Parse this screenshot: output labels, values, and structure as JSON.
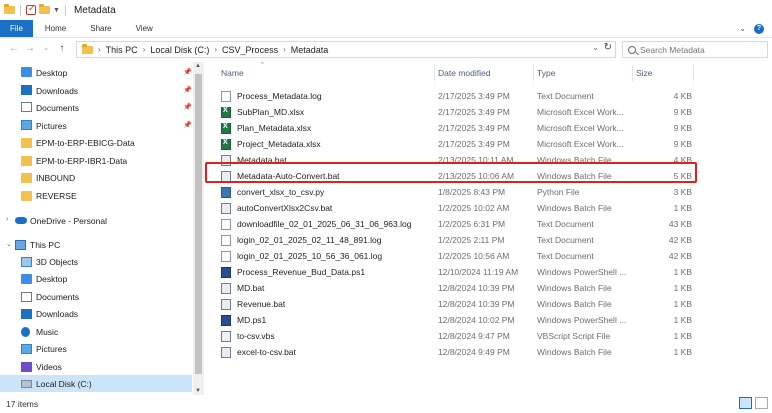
{
  "window": {
    "title": "Metadata"
  },
  "ribbon": {
    "tabs": [
      "File",
      "Home",
      "Share",
      "View"
    ],
    "chevron": "⌄",
    "help": "?"
  },
  "address": {
    "segments": [
      "This PC",
      "Local Disk (C:)",
      "CSV_Process",
      "Metadata"
    ],
    "search_placeholder": "Search Metadata"
  },
  "nav": {
    "items": [
      {
        "label": "Desktop",
        "icon": "desktop-icon",
        "pinned": true
      },
      {
        "label": "Downloads",
        "icon": "downloads-icon",
        "pinned": true
      },
      {
        "label": "Documents",
        "icon": "documents-icon",
        "pinned": true
      },
      {
        "label": "Pictures",
        "icon": "pictures-icon",
        "pinned": true
      },
      {
        "label": "EPM-to-ERP-EBICG-Data",
        "icon": "folder-icon"
      },
      {
        "label": "EPM-to-ERP-IBR1-Data",
        "icon": "folder-icon"
      },
      {
        "label": "INBOUND",
        "icon": "folder-icon"
      },
      {
        "label": "REVERSE",
        "icon": "folder-icon"
      },
      {
        "label": "OneDrive - Personal",
        "icon": "onedrive-icon"
      },
      {
        "label": "This PC",
        "icon": "this-pc-icon"
      },
      {
        "label": "3D Objects",
        "icon": "3d-objects-icon"
      },
      {
        "label": "Desktop",
        "icon": "desktop-icon"
      },
      {
        "label": "Documents",
        "icon": "documents-icon"
      },
      {
        "label": "Downloads",
        "icon": "downloads-icon"
      },
      {
        "label": "Music",
        "icon": "music-icon"
      },
      {
        "label": "Pictures",
        "icon": "pictures-icon"
      },
      {
        "label": "Videos",
        "icon": "videos-icon"
      },
      {
        "label": "Local Disk (C:)",
        "icon": "local-disk-icon",
        "selected": true
      }
    ]
  },
  "columns": {
    "name": "Name",
    "date": "Date modified",
    "type": "Type",
    "size": "Size"
  },
  "files": [
    {
      "name": "Process_Metadata.log",
      "date": "2/17/2025 3:49 PM",
      "type": "Text Document",
      "size": "4 KB",
      "kind": "log"
    },
    {
      "name": "SubPlan_MD.xlsx",
      "date": "2/17/2025 3:49 PM",
      "type": "Microsoft Excel Work...",
      "size": "9 KB",
      "kind": "xlsx"
    },
    {
      "name": "Plan_Metadata.xlsx",
      "date": "2/17/2025 3:49 PM",
      "type": "Microsoft Excel Work...",
      "size": "9 KB",
      "kind": "xlsx"
    },
    {
      "name": "Project_Metadata.xlsx",
      "date": "2/17/2025 3:49 PM",
      "type": "Microsoft Excel Work...",
      "size": "9 KB",
      "kind": "xlsx"
    },
    {
      "name": "Metadata.bat",
      "date": "2/13/2025 10:11 AM",
      "type": "Windows Batch File",
      "size": "4 KB",
      "kind": "bat"
    },
    {
      "name": "Metadata-Auto-Convert.bat",
      "date": "2/13/2025 10:06 AM",
      "type": "Windows Batch File",
      "size": "5 KB",
      "kind": "bat",
      "highlighted": true
    },
    {
      "name": "convert_xlsx_to_csv.py",
      "date": "1/8/2025 8:43 PM",
      "type": "Python File",
      "size": "3 KB",
      "kind": "py"
    },
    {
      "name": "autoConvertXlsx2Csv.bat",
      "date": "1/2/2025 10:02 AM",
      "type": "Windows Batch File",
      "size": "1 KB",
      "kind": "bat"
    },
    {
      "name": "downloadfile_02_01_2025_06_31_06_963.log",
      "date": "1/2/2025 6:31 PM",
      "type": "Text Document",
      "size": "43 KB",
      "kind": "log"
    },
    {
      "name": "login_02_01_2025_02_11_48_891.log",
      "date": "1/2/2025 2:11 PM",
      "type": "Text Document",
      "size": "42 KB",
      "kind": "log"
    },
    {
      "name": "login_02_01_2025_10_56_36_061.log",
      "date": "1/2/2025 10:56 AM",
      "type": "Text Document",
      "size": "42 KB",
      "kind": "log"
    },
    {
      "name": "Process_Revenue_Bud_Data.ps1",
      "date": "12/10/2024 11:19 AM",
      "type": "Windows PowerShell ...",
      "size": "1 KB",
      "kind": "ps1"
    },
    {
      "name": "MD.bat",
      "date": "12/8/2024 10:39 PM",
      "type": "Windows Batch File",
      "size": "1 KB",
      "kind": "bat"
    },
    {
      "name": "Revenue.bat",
      "date": "12/8/2024 10:39 PM",
      "type": "Windows Batch File",
      "size": "1 KB",
      "kind": "bat"
    },
    {
      "name": "MD.ps1",
      "date": "12/8/2024 10:02 PM",
      "type": "Windows PowerShell ...",
      "size": "1 KB",
      "kind": "ps1"
    },
    {
      "name": "to-csv.vbs",
      "date": "12/8/2024 9:47 PM",
      "type": "VBScript Script File",
      "size": "1 KB",
      "kind": "vbs"
    },
    {
      "name": "excel-to-csv.bat",
      "date": "12/8/2024 9:49 PM",
      "type": "Windows Batch File",
      "size": "1 KB",
      "kind": "bat"
    }
  ],
  "status": {
    "item_count": "17 items"
  },
  "colors": {
    "accent": "#1a6fc6",
    "selection": "#cce4f7",
    "highlight_border": "#e0201e"
  }
}
